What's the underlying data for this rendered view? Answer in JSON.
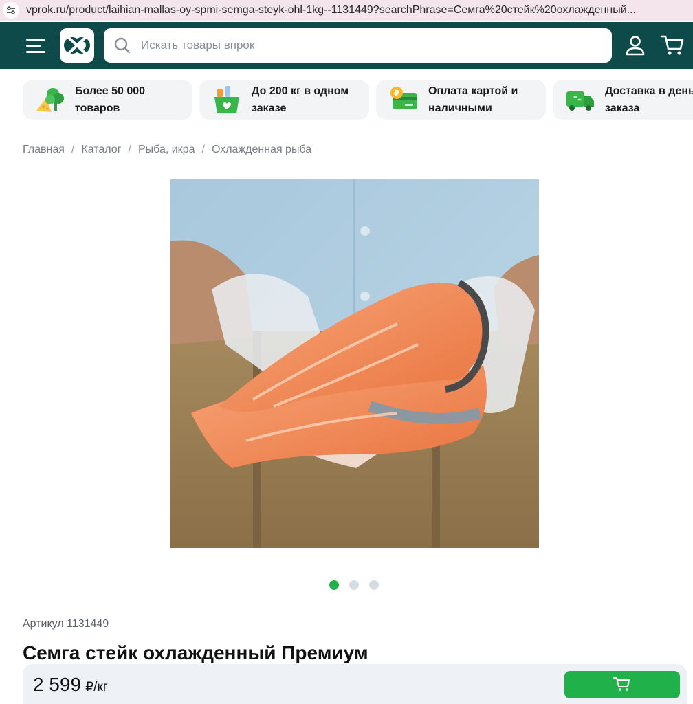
{
  "browser": {
    "url": "vprok.ru/product/laihian-mallas-oy-spmi-semga-steyk-ohl-1kg--1131449?searchPhrase=Семга%20стейк%20охлажденный..."
  },
  "header": {
    "search_placeholder": "Искать товары впрок",
    "icons": [
      "menu-icon",
      "logo",
      "search-icon",
      "user-icon",
      "cart-icon"
    ],
    "background": "#0e4a4a"
  },
  "promos": [
    {
      "label": "Более 50 000\nтоваров",
      "icon": "veggies-cheese-icon"
    },
    {
      "label": "До 200 кг в одном\nзаказе",
      "icon": "grocery-bag-icon"
    },
    {
      "label": "Оплата картой и\nналичными",
      "icon": "card-coin-icon"
    },
    {
      "label": "Доставка в день\nзаказа",
      "icon": "delivery-truck-icon"
    }
  ],
  "breadcrumbs": [
    "Главная",
    "Каталог",
    "Рыба, икра",
    "Охлажденная рыба"
  ],
  "gallery": {
    "slides": 3,
    "active_index": 0
  },
  "product": {
    "sku_label": "Артикул 1131449",
    "title": "Семга стейк охлажденный Премиум",
    "price": "2 599",
    "price_unit": "₽/кг"
  },
  "colors": {
    "accent": "#21b14a",
    "header": "#0e4a4a"
  }
}
